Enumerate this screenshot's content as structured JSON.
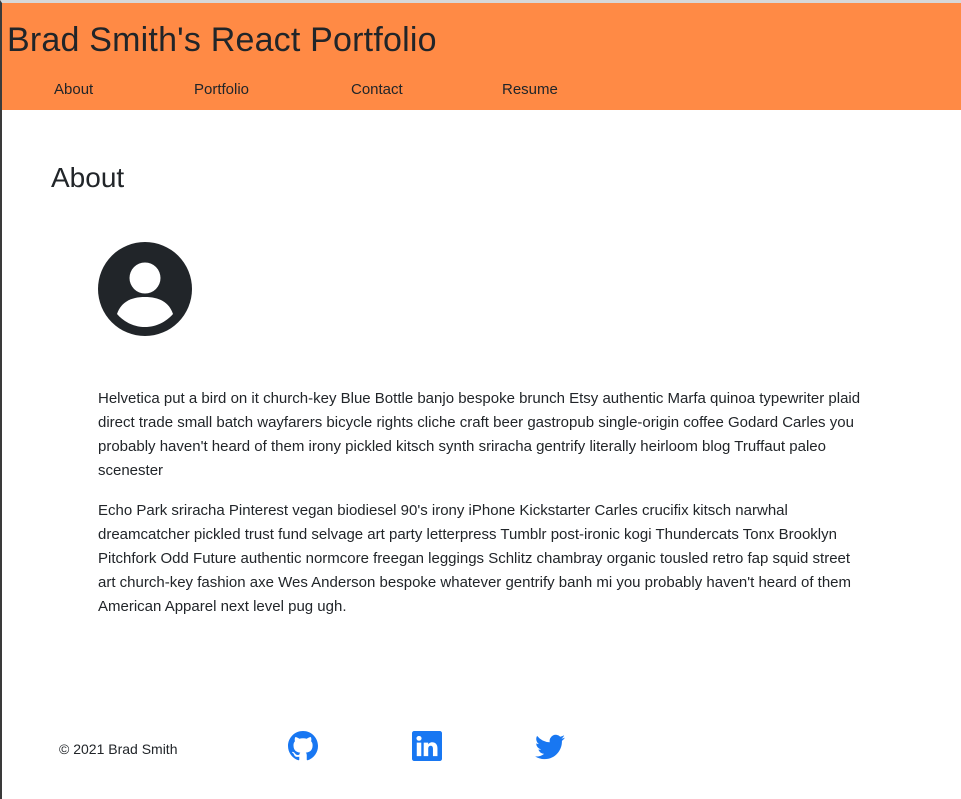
{
  "header": {
    "title": "Brad Smith's React Portfolio",
    "nav": {
      "about": "About",
      "portfolio": "Portfolio",
      "contact": "Contact",
      "resume": "Resume"
    },
    "background_color": "#ff8a45"
  },
  "main": {
    "section_title": "About",
    "avatar_icon": "user-circle-icon",
    "paragraphs": [
      "Helvetica put a bird on it church-key Blue Bottle banjo bespoke brunch Etsy authentic Marfa quinoa typewriter plaid direct trade small batch wayfarers bicycle rights cliche craft beer gastropub single-origin coffee Godard Carles you probably haven't heard of them irony pickled kitsch synth sriracha gentrify literally heirloom blog Truffaut paleo scenester",
      "Echo Park sriracha Pinterest vegan biodiesel 90's irony iPhone Kickstarter Carles crucifix kitsch narwhal dreamcatcher pickled trust fund selvage art party letterpress Tumblr post-ironic kogi Thundercats Tonx Brooklyn Pitchfork Odd Future authentic normcore freegan leggings Schlitz chambray organic tousled retro fap squid street art church-key fashion axe Wes Anderson bespoke whatever gentrify banh mi you probably haven't heard of them American Apparel next level pug ugh."
    ]
  },
  "footer": {
    "copyright": "© 2021 Brad Smith",
    "social": [
      {
        "icon": "github-icon"
      },
      {
        "icon": "linkedin-icon"
      },
      {
        "icon": "twitter-icon"
      }
    ],
    "icon_color": "#1877f2"
  }
}
